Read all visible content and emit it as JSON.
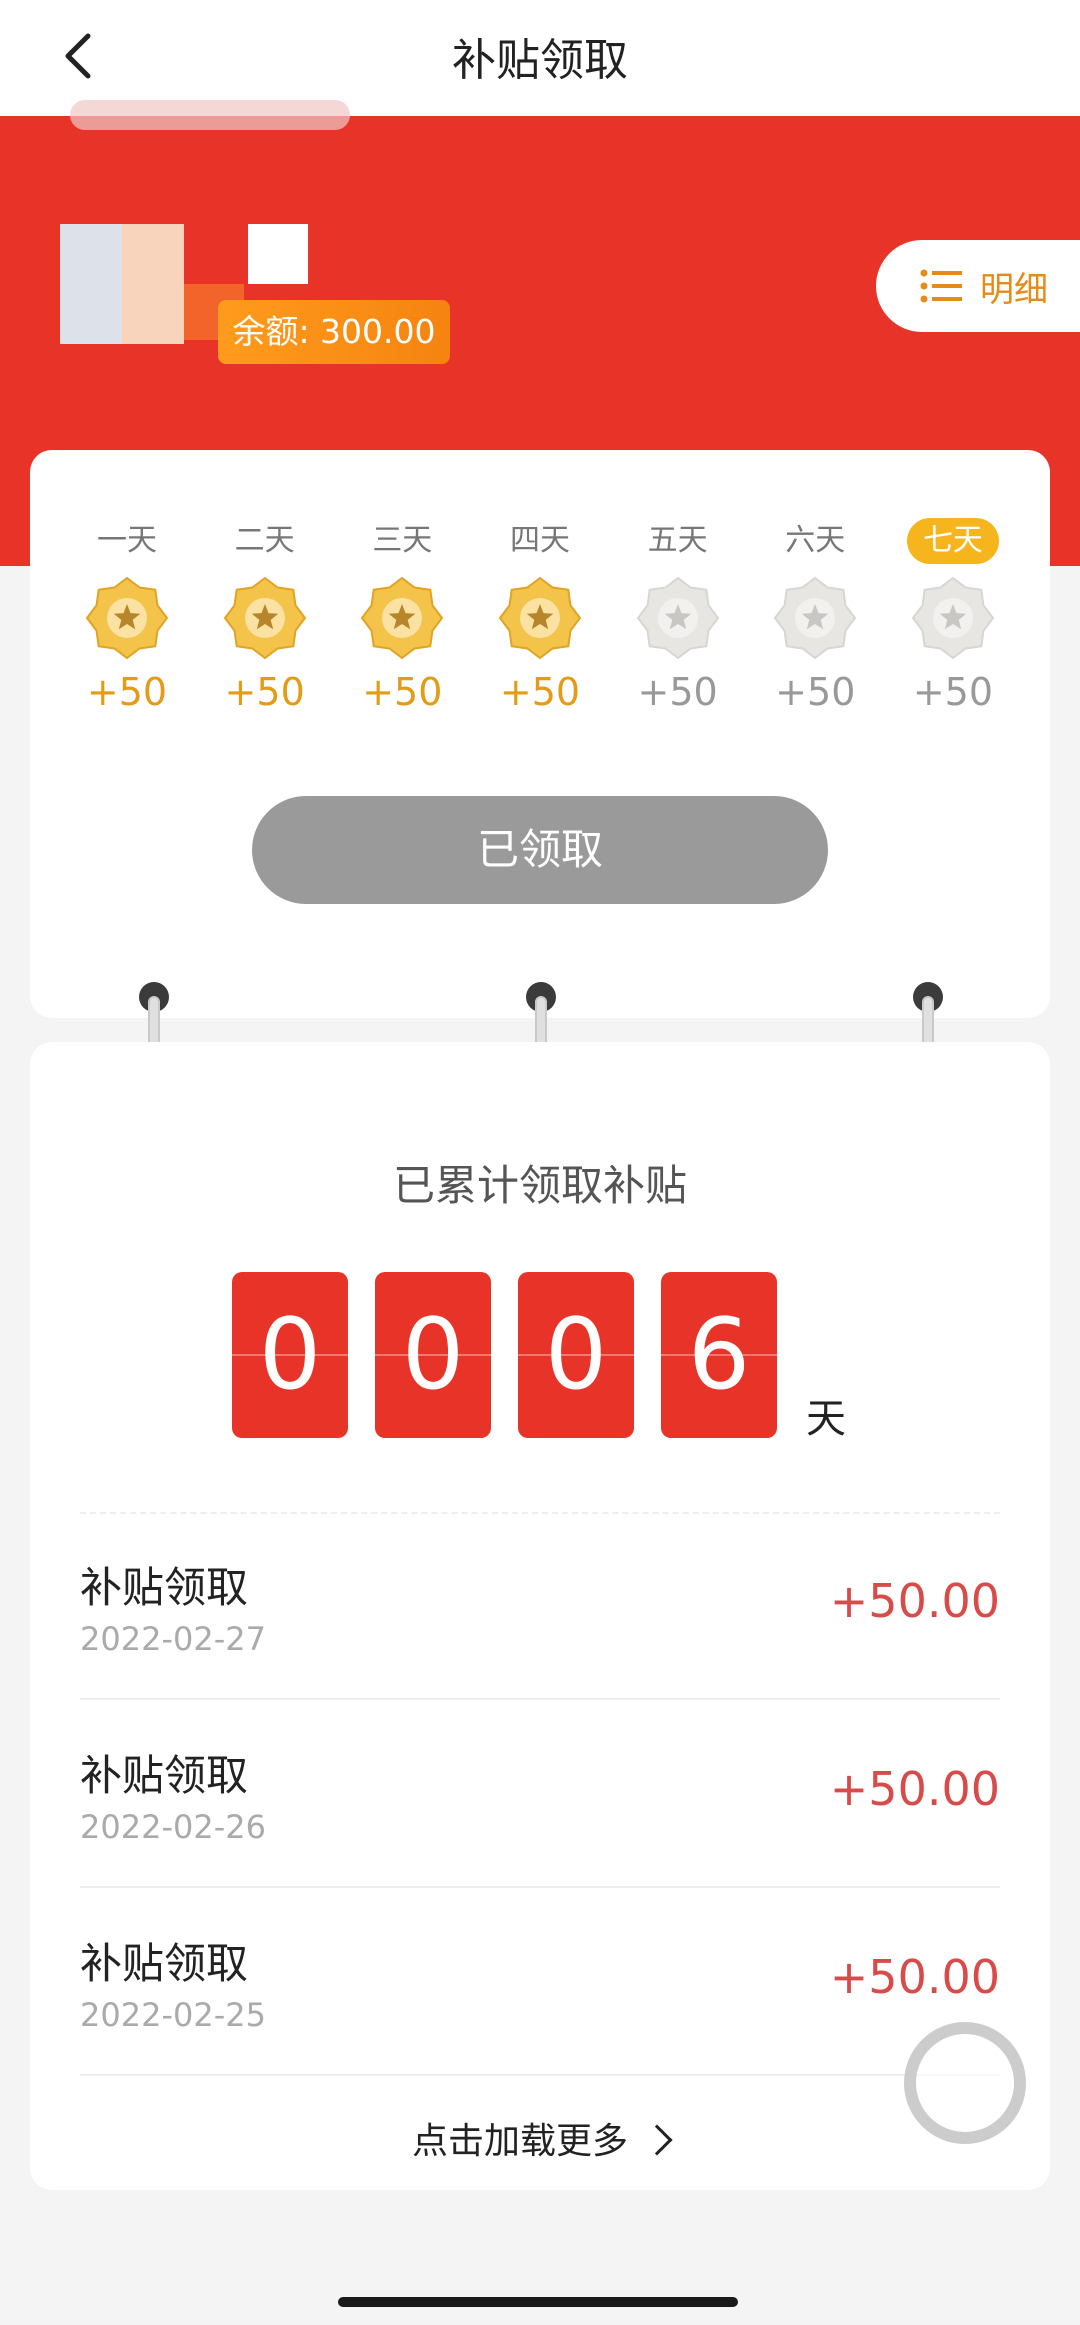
{
  "nav": {
    "title": "补贴领取",
    "back_icon": "chevron-left-icon"
  },
  "header": {
    "balance_label": "余额: 300.00",
    "detail_label": "明细",
    "detail_icon": "list-icon",
    "accent_color": "#e83428"
  },
  "signin": {
    "days": [
      {
        "label": "一天",
        "points": "+50",
        "claimed": true
      },
      {
        "label": "二天",
        "points": "+50",
        "claimed": true
      },
      {
        "label": "三天",
        "points": "+50",
        "claimed": true
      },
      {
        "label": "四天",
        "points": "+50",
        "claimed": true
      },
      {
        "label": "五天",
        "points": "+50",
        "claimed": false
      },
      {
        "label": "六天",
        "points": "+50",
        "claimed": false
      },
      {
        "label": "七天",
        "points": "+50",
        "claimed": false,
        "highlight": true
      }
    ],
    "button_label": "已领取"
  },
  "cumulative": {
    "title": "已累计领取补贴",
    "digits": [
      "0",
      "0",
      "0",
      "6"
    ],
    "unit": "天"
  },
  "records": [
    {
      "title": "补贴领取",
      "date": "2022-02-27",
      "amount": "+50.00"
    },
    {
      "title": "补贴领取",
      "date": "2022-02-26",
      "amount": "+50.00"
    },
    {
      "title": "补贴领取",
      "date": "2022-02-25",
      "amount": "+50.00"
    }
  ],
  "load_more_label": "点击加载更多"
}
